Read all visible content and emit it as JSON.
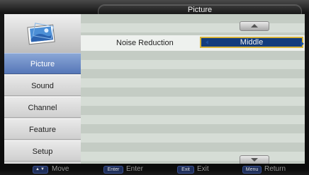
{
  "menu_title": "Picture",
  "sidebar": {
    "items": [
      {
        "label": "Picture",
        "active": true
      },
      {
        "label": "Sound",
        "active": false
      },
      {
        "label": "Channel",
        "active": false
      },
      {
        "label": "Feature",
        "active": false
      },
      {
        "label": "Setup",
        "active": false
      }
    ]
  },
  "settings": {
    "noise_reduction": {
      "label": "Noise Reduction",
      "value": "Middle"
    }
  },
  "help_bar": {
    "move_key": "▲▼",
    "move_label": "Move",
    "enter_key": "Enter",
    "enter_label": "Enter",
    "exit_key": "Exit",
    "exit_label": "Exit",
    "menu_key": "Menu",
    "menu_label": "Return"
  },
  "icons": {
    "logo": "picture-icon",
    "scroll_up": "scroll-up-icon",
    "scroll_down": "scroll-down-icon"
  },
  "colors": {
    "active_item": "#5677b8",
    "value_box": "#123b7c",
    "value_border": "#d7b43a"
  }
}
